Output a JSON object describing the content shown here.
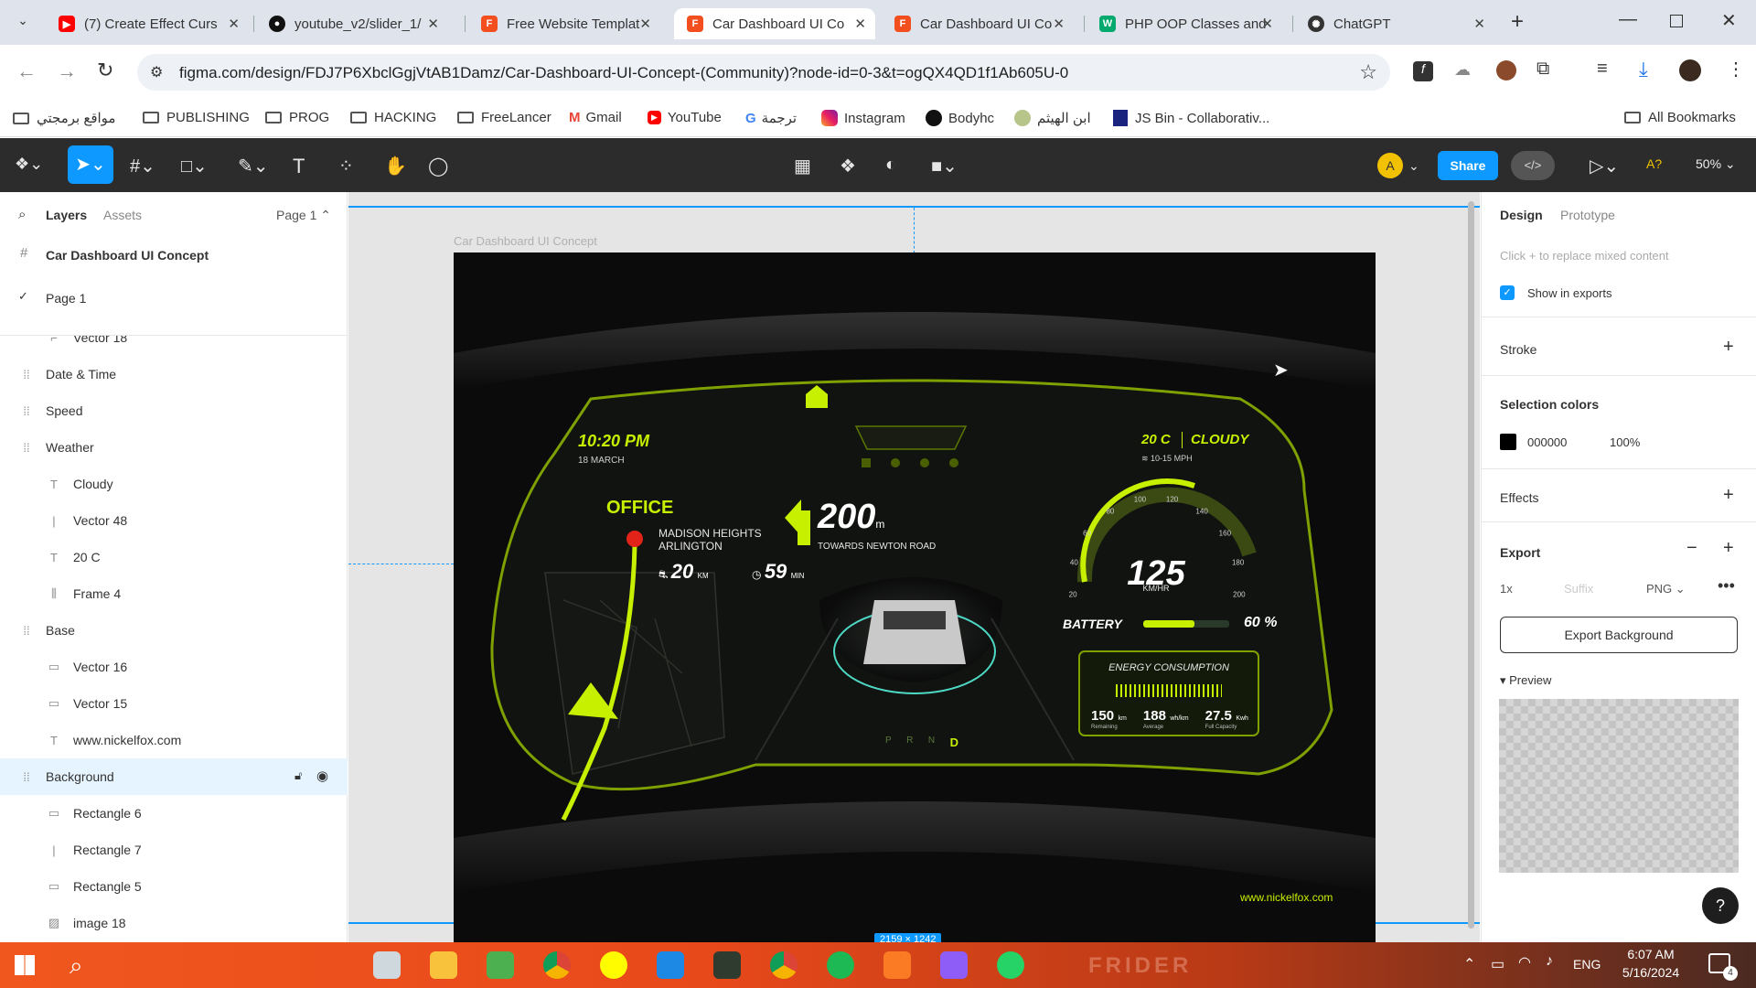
{
  "browser": {
    "tabs": [
      {
        "title": "(7) Create Effect Curs",
        "fav": "youtube",
        "color": "#ff0000"
      },
      {
        "title": "youtube_v2/slider_1/",
        "fav": "github",
        "color": "#111111"
      },
      {
        "title": "Free Website Templat",
        "fav": "figma",
        "color": "#f24e1e"
      },
      {
        "title": "Car Dashboard UI Co",
        "fav": "figma",
        "color": "#f24e1e"
      },
      {
        "title": "Car Dashboard UI Co",
        "fav": "figma",
        "color": "#f24e1e"
      },
      {
        "title": "PHP OOP Classes and",
        "fav": "w3",
        "color": "#04aa6d"
      },
      {
        "title": "ChatGPT",
        "fav": "chatgpt",
        "color": "#333333"
      }
    ],
    "url": "figma.com/design/FDJ7P6XbclGgjVtAB1Damz/Car-Dashboard-UI-Concept-(Community)?node-id=0-3&t=ogQX4QD1f1Ab605U-0",
    "bookmarks": [
      {
        "label": "مواقع برمجتي",
        "type": "folder"
      },
      {
        "label": "PUBLISHING",
        "type": "folder"
      },
      {
        "label": "PROG",
        "type": "folder"
      },
      {
        "label": "HACKING",
        "type": "folder"
      },
      {
        "label": "FreeLancer",
        "type": "folder"
      },
      {
        "label": "Gmail",
        "type": "gmail"
      },
      {
        "label": "YouTube",
        "type": "youtube"
      },
      {
        "label": "ترجمة",
        "type": "translate"
      },
      {
        "label": "Instagram",
        "type": "instagram"
      },
      {
        "label": "Bodyhc",
        "type": "github"
      },
      {
        "label": "ابن الهيثم",
        "type": "site"
      },
      {
        "label": "JS Bin - Collaborativ...",
        "type": "jsbin"
      }
    ],
    "all_bookmarks": "All Bookmarks"
  },
  "figma": {
    "share": "Share",
    "avatar": "A",
    "zoom": "50%",
    "tabs": {
      "layers": "Layers",
      "assets": "Assets",
      "page": "Page 1"
    },
    "file_name": "Car Dashboard UI Concept",
    "page_item": "Page 1",
    "layers": [
      {
        "name": "Vector 18",
        "indent": 2,
        "icon": "vector"
      },
      {
        "name": "Date & Time",
        "indent": 1,
        "icon": "group"
      },
      {
        "name": "Speed",
        "indent": 1,
        "icon": "group"
      },
      {
        "name": "Weather",
        "indent": 1,
        "icon": "group"
      },
      {
        "name": "Cloudy",
        "indent": 2,
        "icon": "text"
      },
      {
        "name": "Vector 48",
        "indent": 2,
        "icon": "line"
      },
      {
        "name": "20 C",
        "indent": 2,
        "icon": "text"
      },
      {
        "name": "Frame 4",
        "indent": 2,
        "icon": "frame"
      },
      {
        "name": "Base",
        "indent": 1,
        "icon": "group"
      },
      {
        "name": "Vector 16",
        "indent": 2,
        "icon": "rect"
      },
      {
        "name": "Vector 15",
        "indent": 2,
        "icon": "rect"
      },
      {
        "name": "www.nickelfox.com",
        "indent": 2,
        "icon": "text"
      },
      {
        "name": "Background",
        "indent": 1,
        "icon": "group",
        "selected": true
      },
      {
        "name": "Rectangle 6",
        "indent": 2,
        "icon": "rect"
      },
      {
        "name": "Rectangle 7",
        "indent": 2,
        "icon": "line"
      },
      {
        "name": "Rectangle 5",
        "indent": 2,
        "icon": "rect"
      },
      {
        "name": "image 18",
        "indent": 2,
        "icon": "image"
      }
    ],
    "canvas": {
      "frame_label": "Car Dashboard UI Concept",
      "size_badge": "2159 × 1242"
    },
    "design": {
      "tab_design": "Design",
      "tab_prototype": "Prototype",
      "mixed_hint": "Click + to replace mixed content",
      "show_in_exports": "Show in exports",
      "stroke": "Stroke",
      "selection_colors": "Selection colors",
      "color_hex": "000000",
      "color_opacity": "100%",
      "effects": "Effects",
      "export": "Export",
      "export_scale": "1x",
      "export_suffix": "Suffix",
      "export_format": "PNG",
      "export_button": "Export Background",
      "preview": "Preview",
      "help": "?"
    }
  },
  "dashboard": {
    "time": "10:20 PM",
    "date": "18 MARCH",
    "weather_temp": "20 C",
    "weather_state": "CLOUDY",
    "wind": "10-15 MPH",
    "destination": "OFFICE",
    "address_line1": "MADISON HEIGHTS",
    "address_line2": "ARLINGTON",
    "distance_value": "20",
    "distance_unit": "KM",
    "eta_value": "59",
    "eta_unit": "MIN",
    "turn_distance": "200",
    "turn_unit": "m",
    "turn_road": "TOWARDS NEWTON ROAD",
    "speed": "125",
    "speed_unit": "KM/HR",
    "speed_ticks": [
      "20",
      "40",
      "60",
      "80",
      "100",
      "120",
      "140",
      "160",
      "180",
      "200"
    ],
    "battery_label": "BATTERY",
    "battery_percent": "60 %",
    "battery_level": 0.6,
    "energy_title": "ENERGY CONSUMPTION",
    "energy_stats": [
      {
        "value": "150",
        "unit": "km",
        "label": "Remaining"
      },
      {
        "value": "188",
        "unit": "wh/km",
        "label": "Average"
      },
      {
        "value": "27.5",
        "unit": "Kwh",
        "label": "Full Capacity"
      }
    ],
    "gears": [
      "P",
      "R",
      "N",
      "D"
    ],
    "active_gear": "D",
    "website": "www.nickelfox.com",
    "accent": "#c7f000"
  },
  "taskbar": {
    "lang": "ENG",
    "time": "6:07 AM",
    "date": "5/16/2024",
    "notifications": "4",
    "wallpaper_text": "FRIDER"
  }
}
